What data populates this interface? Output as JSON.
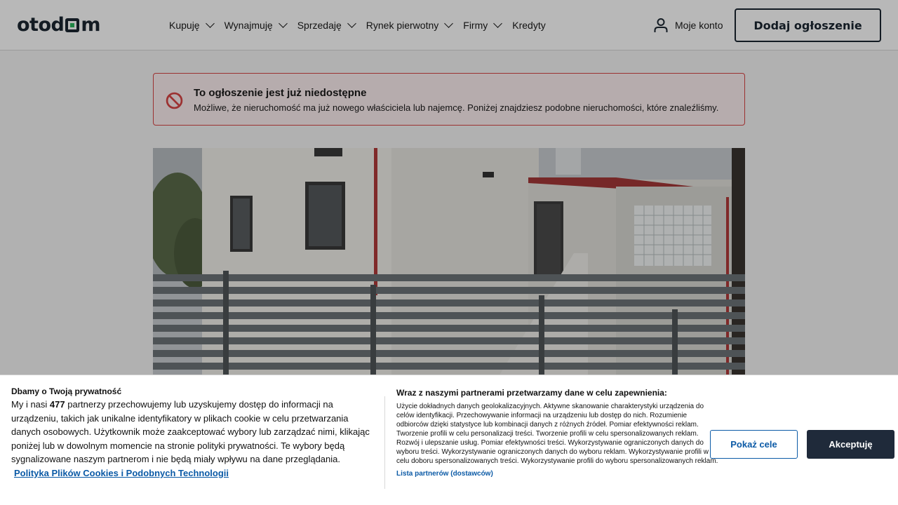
{
  "header": {
    "logo_text": "otodom",
    "nav": [
      {
        "label": "Kupuję",
        "has_dropdown": true
      },
      {
        "label": "Wynajmuję",
        "has_dropdown": true
      },
      {
        "label": "Sprzedaję",
        "has_dropdown": true
      },
      {
        "label": "Rynek pierwotny",
        "has_dropdown": true
      },
      {
        "label": "Firmy",
        "has_dropdown": true
      },
      {
        "label": "Kredyty",
        "has_dropdown": false
      }
    ],
    "account_label": "Moje konto",
    "add_listing_label": "Dodaj ogłoszenie"
  },
  "alert": {
    "title": "To ogłoszenie jest już niedostępne",
    "text": "Możliwe, że nieruchomość ma już nowego właściciela lub najemcę. Poniżej znajdziesz podobne nieruchomości, które znaleźliśmy.",
    "icon": "no-entry-icon",
    "color": "#d94545"
  },
  "photo": {
    "subject": "house-photo"
  },
  "cookie": {
    "title": "Dbamy o Twoją prywatność",
    "body_prefix": "My i nasi",
    "partners_count": "477",
    "body_suffix": "partnerzy przechowujemy lub uzyskujemy dostęp do informacji na urządzeniu, takich jak unikalne identyfikatory w plikach cookie w celu przetwarzania danych osobowych. Użytkownik może zaakceptować wybory lub zarządzać nimi, klikając poniżej lub w dowolnym momencie na stronie polityki prywatności. Te wybory będą sygnalizowane naszym partnerom i nie będą miały wpływu na dane przeglądania.",
    "policy_link": "Polityka Plików Cookies i Podobnych Technologii",
    "purposes_title": "Wraz z naszymi partnerami przetwarzamy dane w celu zapewnienia:",
    "purposes_text": "Użycie dokładnych danych geolokalizacyjnych. Aktywne skanowanie charakterystyki urządzenia do celów identyfikacji. Przechowywanie informacji na urządzeniu lub dostęp do nich. Rozumienie odbiorców dzięki statystyce lub kombinacji danych z różnych źródeł. Pomiar efektywności reklam. Tworzenie profili w celu personalizacji treści. Tworzenie profili w celu spersonalizowanych reklam. Rozwój i ulepszanie usług. Pomiar efektywności treści. Wykorzystywanie ograniczonych danych do wyboru treści. Wykorzystywanie ograniczonych danych do wyboru reklam. Wykorzystywanie profili w celu doboru spersonalizowanych treści. Wykorzystywanie profili do wyboru spersonalizowanych reklam.",
    "partners_link": "Lista partnerów (dostawców)",
    "show_purposes_label": "Pokaż cele",
    "accept_label": "Akceptuję",
    "accent_color": "#0b5aa6",
    "accept_color": "#1f2a3a"
  }
}
